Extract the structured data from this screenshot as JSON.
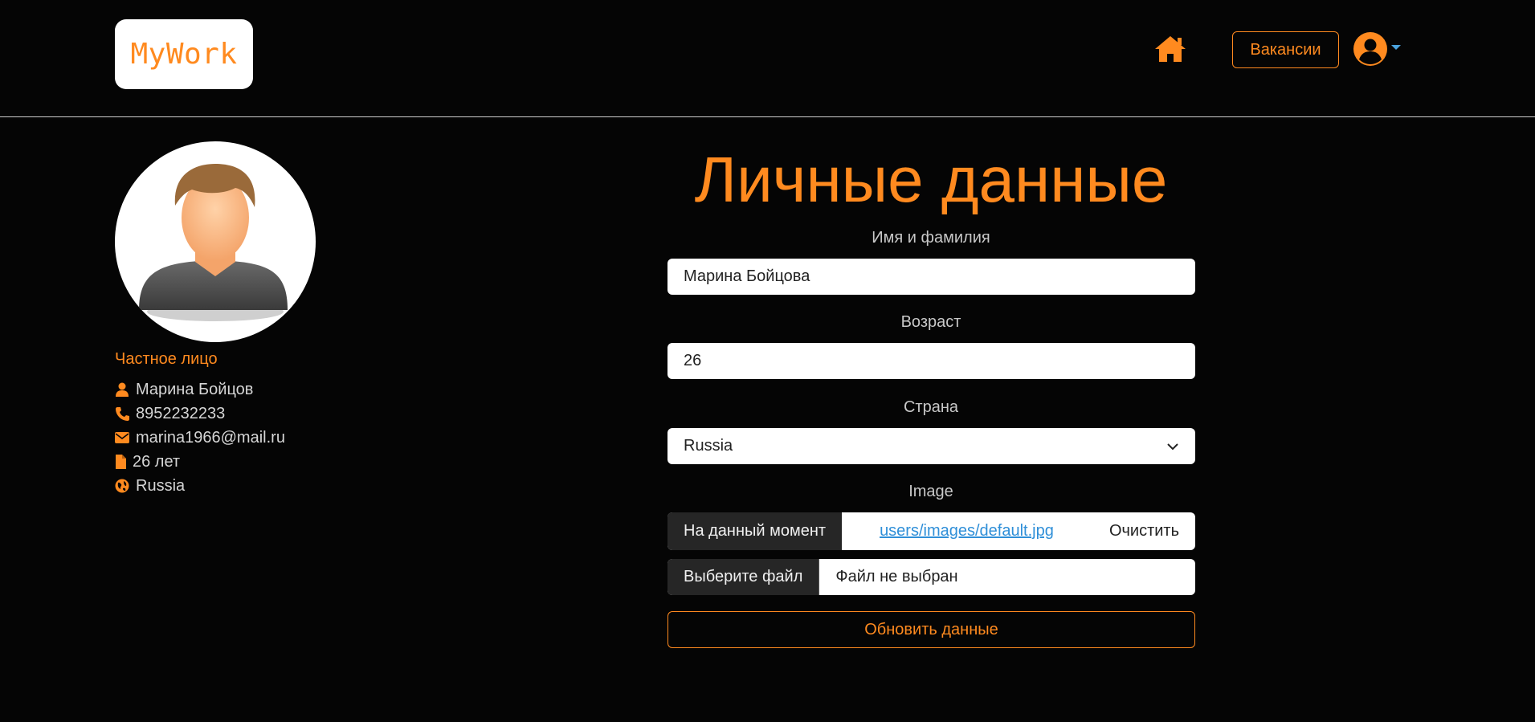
{
  "header": {
    "logo_text": "MyWork",
    "home_icon": "home-icon",
    "vacancies_label": "Вакансии",
    "user_icon": "user-circle-icon"
  },
  "profile": {
    "type_label": "Частное лицо",
    "name": "Марина Бойцов",
    "phone": "8952232233",
    "email": "marina1966@mail.ru",
    "age": "26 лет",
    "country": "Russia"
  },
  "form": {
    "title": "Личные данные",
    "name_label": "Имя и фамилия",
    "name_value": "Марина Бойцова",
    "age_label": "Возраст",
    "age_value": "26",
    "country_label": "Страна",
    "country_value": "Russia",
    "image_label": "Image",
    "current_label": "На данный момент",
    "current_path": "users/images/default.jpg",
    "clear_label": "Очистить",
    "choose_file_label": "Выберите файл",
    "no_file_label": "Файл не выбран",
    "submit_label": "Обновить данные"
  },
  "colors": {
    "accent": "#ff8a1f",
    "background": "#050505",
    "link": "#2f8fd8"
  }
}
